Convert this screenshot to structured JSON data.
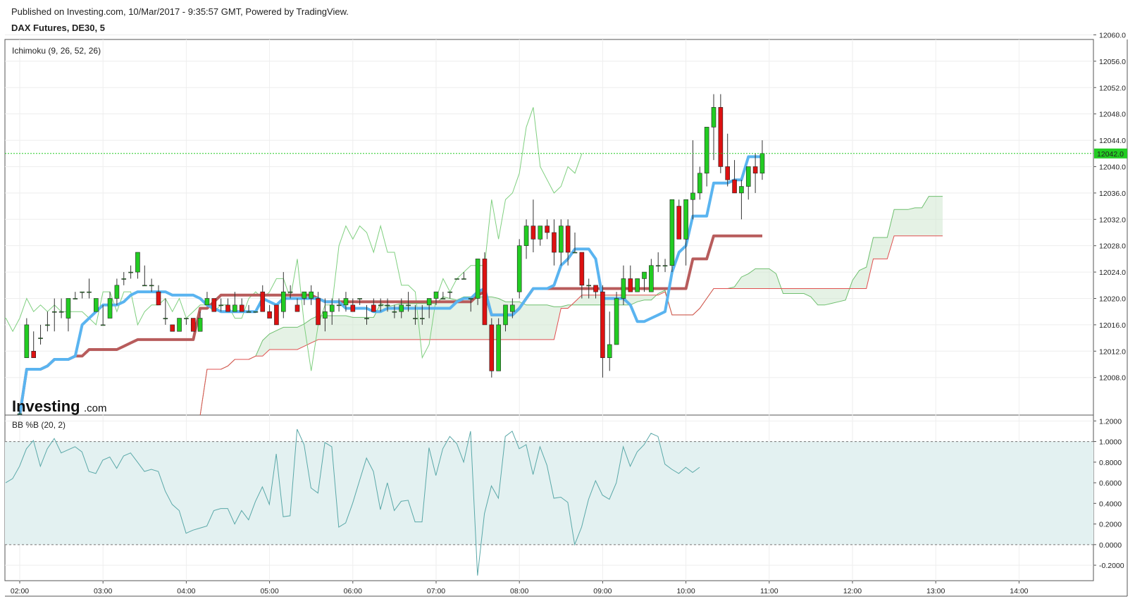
{
  "header": {
    "published": "Published on Investing.com, 10/Mar/2017 - 9:35:57 GMT, Powered by TradingView.",
    "symbol": "DAX Futures, DE30, 5"
  },
  "logo": {
    "brand": "Investing",
    "suffix": ".com"
  },
  "colors": {
    "tenkan": "#5ab4f0",
    "kijun": "#b85c5c",
    "up": "#22cc22",
    "down": "#dd1111",
    "span_a": "#6fbf6f",
    "span_b": "#e05050",
    "chikou": "#7fcf7f",
    "bb_line": "#5aa8a8",
    "bb_fill": "#e3f1f1",
    "last_price": "#22cc22"
  },
  "chart_data": [
    {
      "type": "candlestick",
      "title": "Ichimoku (9, 26, 52, 26)",
      "x_ticks": [
        "02:00",
        "03:00",
        "04:00",
        "05:00",
        "06:00",
        "07:00",
        "08:00",
        "09:00",
        "10:00",
        "11:00",
        "12:00",
        "13:00",
        "14:00"
      ],
      "y_ticks": [
        "12008.0",
        "12012.0",
        "12016.0",
        "12020.0",
        "12024.0",
        "12028.0",
        "12032.0",
        "12036.0",
        "12040.0",
        "12044.0",
        "12048.0",
        "12052.0",
        "12056.0",
        "12060.0"
      ],
      "y_range": [
        12002.3,
        12059.3
      ],
      "last_price": "12042.0",
      "candles": [
        [
          12002.5,
          12003,
          12001.5,
          12002.5
        ],
        [
          12011,
          12017,
          12011,
          12016
        ],
        [
          12012,
          12015,
          12011,
          12011
        ],
        [
          12014,
          12016,
          12013,
          12014
        ],
        [
          12016,
          12018,
          12015,
          12016
        ],
        [
          12018,
          12020,
          12015,
          12018
        ],
        [
          12018,
          12020,
          12017,
          12018
        ],
        [
          12017,
          12020,
          12015,
          12020
        ],
        [
          12020,
          12021,
          12020,
          12020
        ],
        [
          12021,
          12021,
          12020,
          12021
        ],
        [
          12021,
          12023,
          12020,
          12021
        ],
        [
          12018,
          12020,
          12018,
          12020
        ],
        [
          12016,
          12019,
          12016,
          12016
        ],
        [
          12017,
          12021,
          12017,
          12020
        ],
        [
          12020,
          12023,
          12019,
          12022
        ],
        [
          12023,
          12024,
          12022,
          12023
        ],
        [
          12024,
          12025,
          12023,
          12024
        ],
        [
          12024,
          12026,
          12023,
          12027
        ],
        [
          12022,
          12025,
          12022,
          12022
        ],
        [
          12022,
          12023,
          12021,
          12022
        ],
        [
          12021,
          12022,
          12019,
          12019
        ],
        [
          12017,
          12020,
          12016,
          12017
        ],
        [
          12016,
          12016,
          12015,
          12015
        ],
        [
          12015,
          12017,
          12015,
          12017
        ],
        [
          12017,
          12017,
          12016,
          12017
        ],
        [
          12017,
          12017,
          12015,
          12015
        ],
        [
          12015,
          12018,
          12015,
          12017
        ],
        [
          12019,
          12021,
          12019,
          12020
        ],
        [
          12020,
          12020,
          12018,
          12018
        ],
        [
          12019,
          12020,
          12018,
          12019
        ],
        [
          12019,
          12020,
          12018,
          12018
        ],
        [
          12018,
          12021,
          12018,
          12019
        ],
        [
          12019,
          12020,
          12018,
          12018
        ],
        [
          12018,
          12019,
          12018,
          12018
        ],
        [
          12018,
          12018,
          12018,
          12018
        ],
        [
          12021,
          12022,
          12018,
          12018
        ],
        [
          12018,
          12019,
          12017,
          12017
        ],
        [
          12019,
          12019,
          12016,
          12016
        ],
        [
          12018,
          12024,
          12017,
          12021
        ],
        [
          12021,
          12022,
          12020,
          12021
        ],
        [
          12019,
          12020,
          12018,
          12018
        ],
        [
          12020,
          12021,
          12019,
          12021
        ],
        [
          12020,
          12022,
          12019,
          12021
        ],
        [
          12020,
          12021,
          12016,
          12016
        ],
        [
          12017,
          12020,
          12015,
          12018
        ],
        [
          12018,
          12020,
          12016,
          12019
        ],
        [
          12019,
          12020,
          12018,
          12019
        ],
        [
          12019,
          12021,
          12018,
          12020
        ],
        [
          12019,
          12020,
          12018,
          12018
        ],
        [
          12020,
          12020,
          12019,
          12020
        ],
        [
          12017,
          12019,
          12016,
          12017
        ],
        [
          12019,
          12020,
          12018,
          12018
        ],
        [
          12019,
          12020,
          12018,
          12019
        ],
        [
          12019,
          12020,
          12018,
          12019
        ],
        [
          12018,
          12019,
          12017,
          12018
        ],
        [
          12018,
          12020,
          12017,
          12019
        ],
        [
          12019,
          12021,
          12018,
          12019
        ],
        [
          12017,
          12019,
          12016,
          12017
        ],
        [
          12017,
          12019,
          12016,
          12017
        ],
        [
          12019,
          12020,
          12017,
          12020
        ],
        [
          12020,
          12021,
          12019,
          12021
        ],
        [
          12020,
          12021,
          12020,
          12020
        ],
        [
          12021,
          12021,
          12020,
          12021
        ],
        [
          12023,
          12023,
          12023,
          12023
        ],
        [
          12023,
          12024,
          12023,
          12023
        ],
        [
          12020,
          12020,
          12018,
          12020
        ],
        [
          12020,
          12026,
          12019,
          12026
        ],
        [
          12026,
          12027,
          12016,
          12016
        ],
        [
          12016,
          12017,
          12008,
          12009
        ],
        [
          12009,
          12017,
          12009,
          12016
        ],
        [
          12016,
          12019,
          12015,
          12019
        ],
        [
          12018,
          12020,
          12017,
          12019
        ],
        [
          12021,
          12029,
          12020,
          12028
        ],
        [
          12028,
          12032,
          12026,
          12031
        ],
        [
          12031,
          12035,
          12027,
          12029
        ],
        [
          12029,
          12031,
          12028,
          12031
        ],
        [
          12031,
          12032,
          12029,
          12030
        ],
        [
          12030,
          12032,
          12025,
          12027
        ],
        [
          12027,
          12032,
          12025,
          12031
        ],
        [
          12031,
          12032,
          12025,
          12027
        ],
        [
          12027,
          12030,
          12027,
          12027
        ],
        [
          12027,
          12022,
          12020,
          12022
        ],
        [
          12022,
          12023,
          12020,
          12022
        ],
        [
          12022,
          12022,
          12020,
          12021
        ],
        [
          12021,
          12022,
          12008,
          12011
        ],
        [
          12011,
          12018,
          12009,
          12013
        ],
        [
          12013,
          12021,
          12013,
          12020
        ],
        [
          12020,
          12025,
          12019,
          12023
        ],
        [
          12023,
          12025,
          12021,
          12021
        ],
        [
          12021,
          12023,
          12021,
          12023
        ],
        [
          12023,
          12024,
          12021,
          12024
        ],
        [
          12021,
          12026,
          12021,
          12025
        ],
        [
          12025,
          12027,
          12024,
          12025
        ],
        [
          12025,
          12026,
          12024,
          12025
        ],
        [
          12025,
          12035,
          12024,
          12035
        ],
        [
          12034,
          12035,
          12029,
          12029
        ],
        [
          12029,
          12032,
          12025,
          12035
        ],
        [
          12035,
          12044,
          12032,
          12036
        ],
        [
          12036,
          12040,
          12035,
          12039
        ],
        [
          12039,
          12042,
          12037,
          12046
        ],
        [
          12046,
          12051,
          12041,
          12049
        ],
        [
          12049,
          12051,
          12039,
          12040
        ],
        [
          12040,
          12045,
          12037,
          12038
        ],
        [
          12038,
          12041,
          12036,
          12036
        ],
        [
          12036,
          12038,
          12032,
          12037
        ],
        [
          12037,
          12040,
          12035,
          12040
        ],
        [
          12040,
          12042,
          12036,
          12039
        ],
        [
          12039,
          12044,
          12038,
          12042
        ]
      ]
    },
    {
      "type": "line",
      "title": "BB %B (20, 2)",
      "y_ticks": [
        "-0.2000",
        "0.0000",
        "0.2000",
        "0.4000",
        "0.6000",
        "0.8000",
        "1.0000",
        "1.2000"
      ],
      "y_range": [
        -0.35,
        1.25
      ],
      "band": [
        0,
        1
      ],
      "values": [
        0.6,
        0.64,
        0.76,
        0.93,
        1.01,
        0.76,
        0.93,
        1.03,
        0.89,
        0.92,
        0.95,
        0.9,
        0.71,
        0.69,
        0.82,
        0.85,
        0.74,
        0.86,
        0.89,
        0.8,
        0.71,
        0.73,
        0.71,
        0.52,
        0.39,
        0.33,
        0.11,
        0.14,
        0.16,
        0.18,
        0.33,
        0.35,
        0.35,
        0.2,
        0.33,
        0.24,
        0.42,
        0.56,
        0.39,
        0.88,
        0.27,
        0.28,
        1.12,
        0.97,
        0.55,
        0.5,
        0.99,
        0.95,
        0.17,
        0.21,
        0.4,
        0.62,
        0.84,
        0.71,
        0.34,
        0.6,
        0.33,
        0.42,
        0.43,
        0.22,
        0.22,
        0.94,
        0.67,
        0.93,
        1.05,
        0.98,
        0.8,
        1.1,
        -0.3,
        0.3,
        0.57,
        0.45,
        1.05,
        1.1,
        0.93,
        0.97,
        0.68,
        0.95,
        0.77,
        0.45,
        0.46,
        0.41,
        0.0,
        0.17,
        0.44,
        0.62,
        0.48,
        0.44,
        0.6,
        0.95,
        0.76,
        0.9,
        0.97,
        1.08,
        1.05,
        0.78,
        0.73,
        0.69,
        0.75,
        0.7,
        0.75
      ]
    }
  ]
}
